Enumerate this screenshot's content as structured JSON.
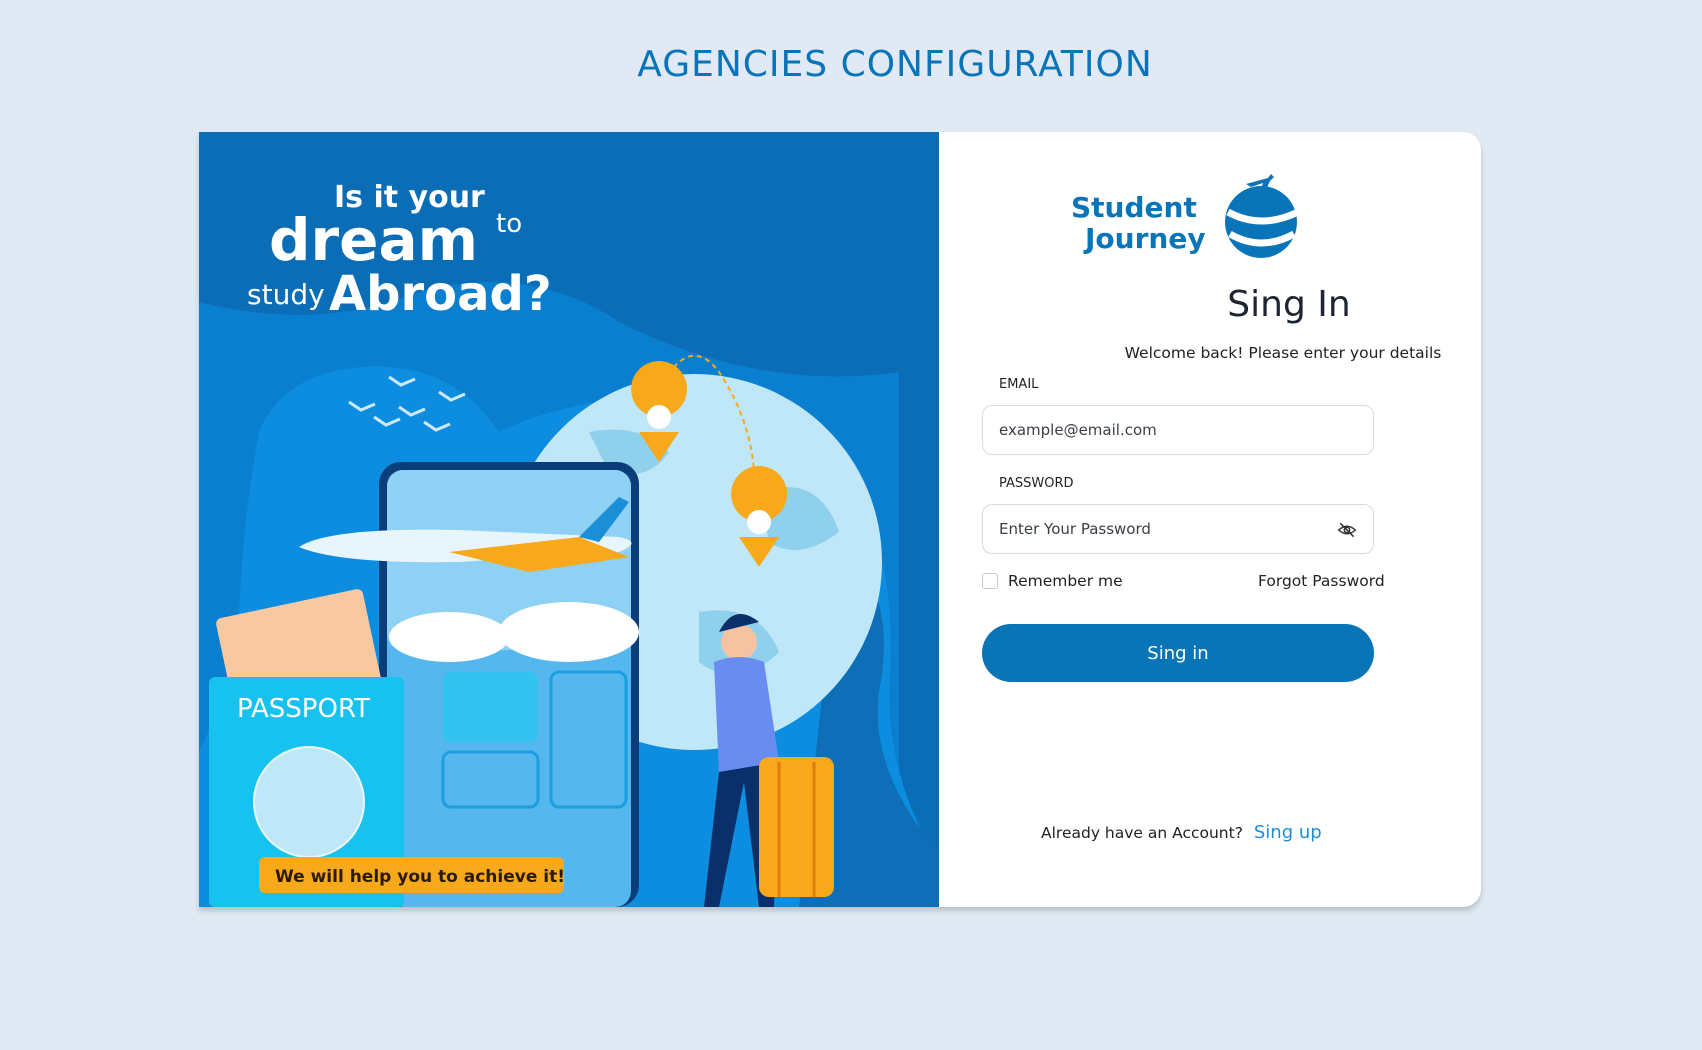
{
  "page": {
    "heading": "AGENCIES CONFIGURATION"
  },
  "illustration": {
    "headline": {
      "line1": "Is it your",
      "dream": "dream",
      "to": "to",
      "study": "study",
      "abroad": "Abroad?"
    },
    "passport_label": "PASSPORT",
    "banner": "We will help you to achieve it!"
  },
  "logo": {
    "line1": "Student",
    "line2": "Journey"
  },
  "form": {
    "title": "Sing In",
    "subtitle": "Welcome back! Please enter your details",
    "email": {
      "label": "EMAIL",
      "placeholder": "example@email.com",
      "value": ""
    },
    "password": {
      "label": "PASSWORD",
      "placeholder": "Enter Your Password",
      "value": "",
      "toggle_icon": "eye-off-icon"
    },
    "remember_label": "Remember me",
    "remember_checked": false,
    "forgot_label": "Forgot Password",
    "submit_label": "Sing in",
    "signup_prompt": "Already have an Account?",
    "signup_link": "Sing up"
  },
  "colors": {
    "primary": "#0975b7",
    "accent_orange": "#f7a81b",
    "background": "#e1eaf4",
    "link": "#1a8fd6"
  }
}
